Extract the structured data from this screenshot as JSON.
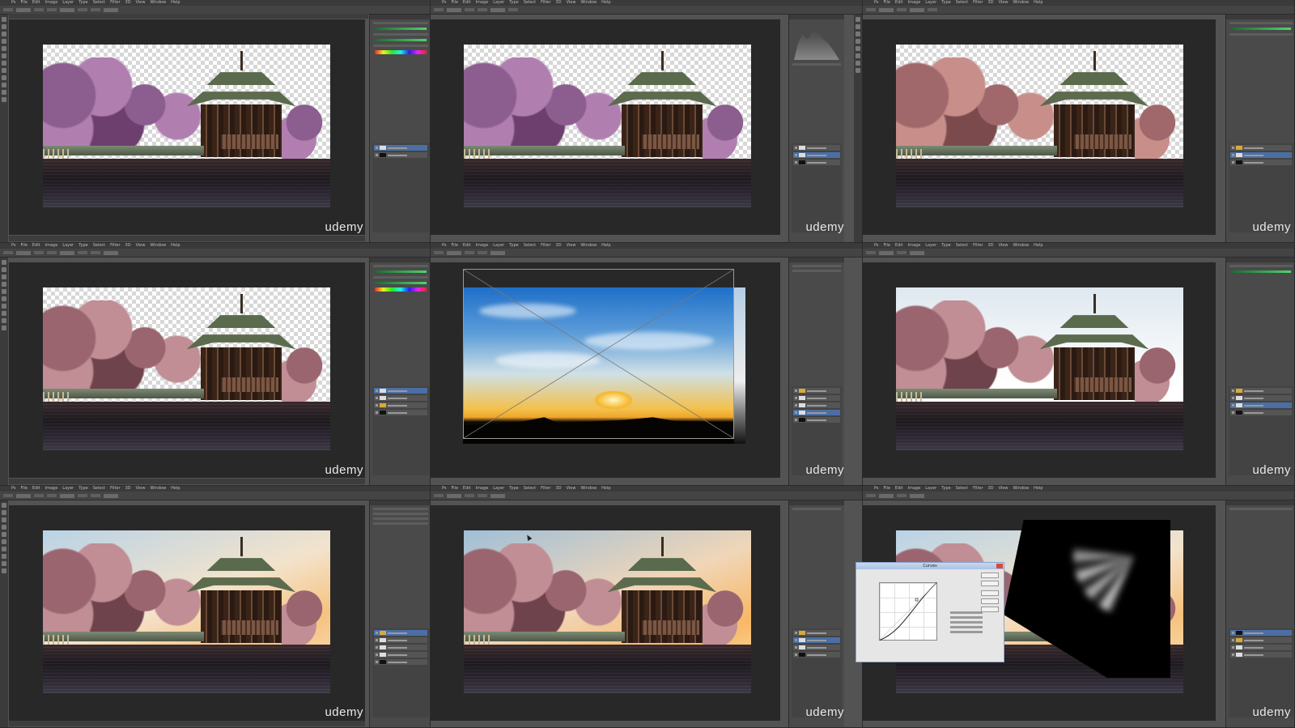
{
  "watermark": "udemy",
  "menu": [
    "Ps",
    "File",
    "Edit",
    "Image",
    "Layer",
    "Type",
    "Select",
    "Filter",
    "3D",
    "View",
    "Window",
    "Help"
  ],
  "dialog": {
    "title": "Curves"
  },
  "colors": {
    "workspace": "#282828",
    "panel": "#4a4a4a",
    "chrome": "#535353",
    "layer_selected": "#4b6fa5"
  },
  "icons": [
    "curves-point-icon",
    "eye-icon",
    "close-icon"
  ]
}
